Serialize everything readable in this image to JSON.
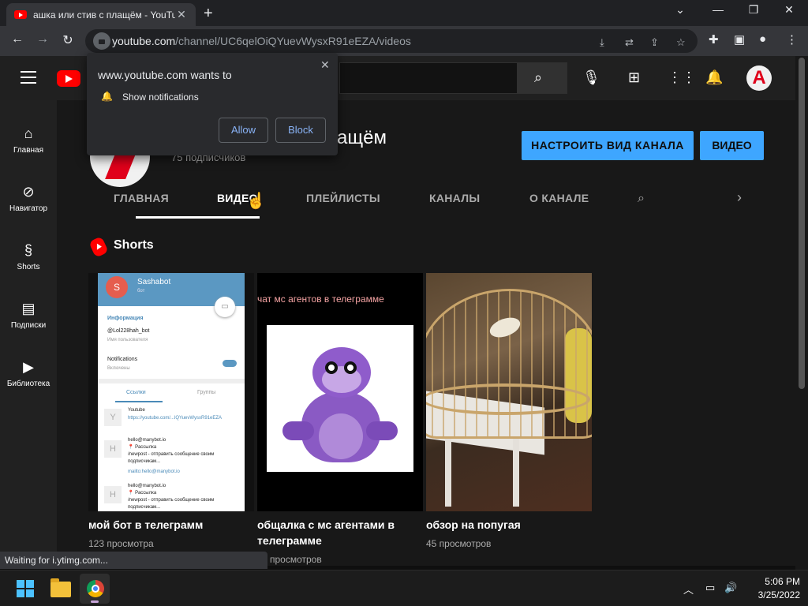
{
  "browser": {
    "tab_title": "ашка или стив с плащём - YouTube",
    "tab_close": "✕",
    "new_tab": "+",
    "url_host": "youtube.com",
    "url_path": "/channel/UC6qelOiQYuevWysxR91eEZA/videos",
    "window_controls": {
      "minimize": "—",
      "restore": "❐",
      "close": "✕",
      "tab_search": "⌄"
    },
    "status_text": "Waiting for i.ytimg.com..."
  },
  "notification_prompt": {
    "title": "www.youtube.com wants to",
    "permission": "Show notifications",
    "allow": "Allow",
    "block": "Block",
    "close": "✕"
  },
  "guide": {
    "items": [
      {
        "label": "Главная",
        "icon": "home-icon"
      },
      {
        "label": "Навигатор",
        "icon": "compass-icon"
      },
      {
        "label": "Shorts",
        "icon": "shorts-icon"
      },
      {
        "label": "Подписки",
        "icon": "subscriptions-icon"
      },
      {
        "label": "Библиотека",
        "icon": "library-icon"
      }
    ]
  },
  "channel": {
    "name": "ащём",
    "subscribers": "75 подписчиков",
    "customize_label": "НАСТРОИТЬ ВИД КАНАЛА",
    "video_label": "ВИДЕО",
    "tabs": [
      "ГЛАВНАЯ",
      "ВИДЕО",
      "ПЛЕЙЛИСТЫ",
      "КАНАЛЫ",
      "О КАНАЛЕ"
    ],
    "active_tab": "ВИДЕО"
  },
  "shorts": {
    "shelf_title": "Shorts",
    "videos": [
      {
        "title": "мой бот в телеграмм",
        "views": "123 просмотра"
      },
      {
        "title": "общалка с мс агентами в телеграмме",
        "views": "просмотров"
      },
      {
        "title": "обзор на попугая",
        "views": "45 просмотров"
      }
    ]
  },
  "thumb1": {
    "bot_name": "Sashabot",
    "bot_sub": "бот",
    "avatar_letter": "S",
    "info_header": "Информация",
    "username": "@Lol228hah_bot",
    "username_hint": "Имя пользователя",
    "notifications": "Notifications",
    "notifications_state": "Включены",
    "tab_links": "Ссылки",
    "tab_groups": "Группы",
    "item1_letter": "Y",
    "item1_title": "Youtube",
    "item1_link": "https://youtube.com/...lQYuevWysxR91eEZA",
    "item2_letter": "H",
    "item2_title": "hello@manybot.io",
    "item2_line1": "📍 Рассылка",
    "item2_line2": "/newpost - отправить сообщение своим",
    "item2_line3": "подписчикам...",
    "item2_link": "mailto:hello@manybot.io",
    "item3_letter": "H",
    "item3_title": "hello@manybot.io",
    "item3_line1": "📍 Рассылка",
    "item3_line2": "/newpost - отправить сообщение своим",
    "item3_line3": "подписчикам..."
  },
  "thumb2": {
    "caption": "чат мс агентов в телеграмме"
  },
  "taskbar": {
    "time": "5:06 PM",
    "date": "3/25/2022"
  },
  "colors": {
    "accent": "#3ea6ff",
    "youtube_red": "#ff0000",
    "background": "#181818"
  }
}
